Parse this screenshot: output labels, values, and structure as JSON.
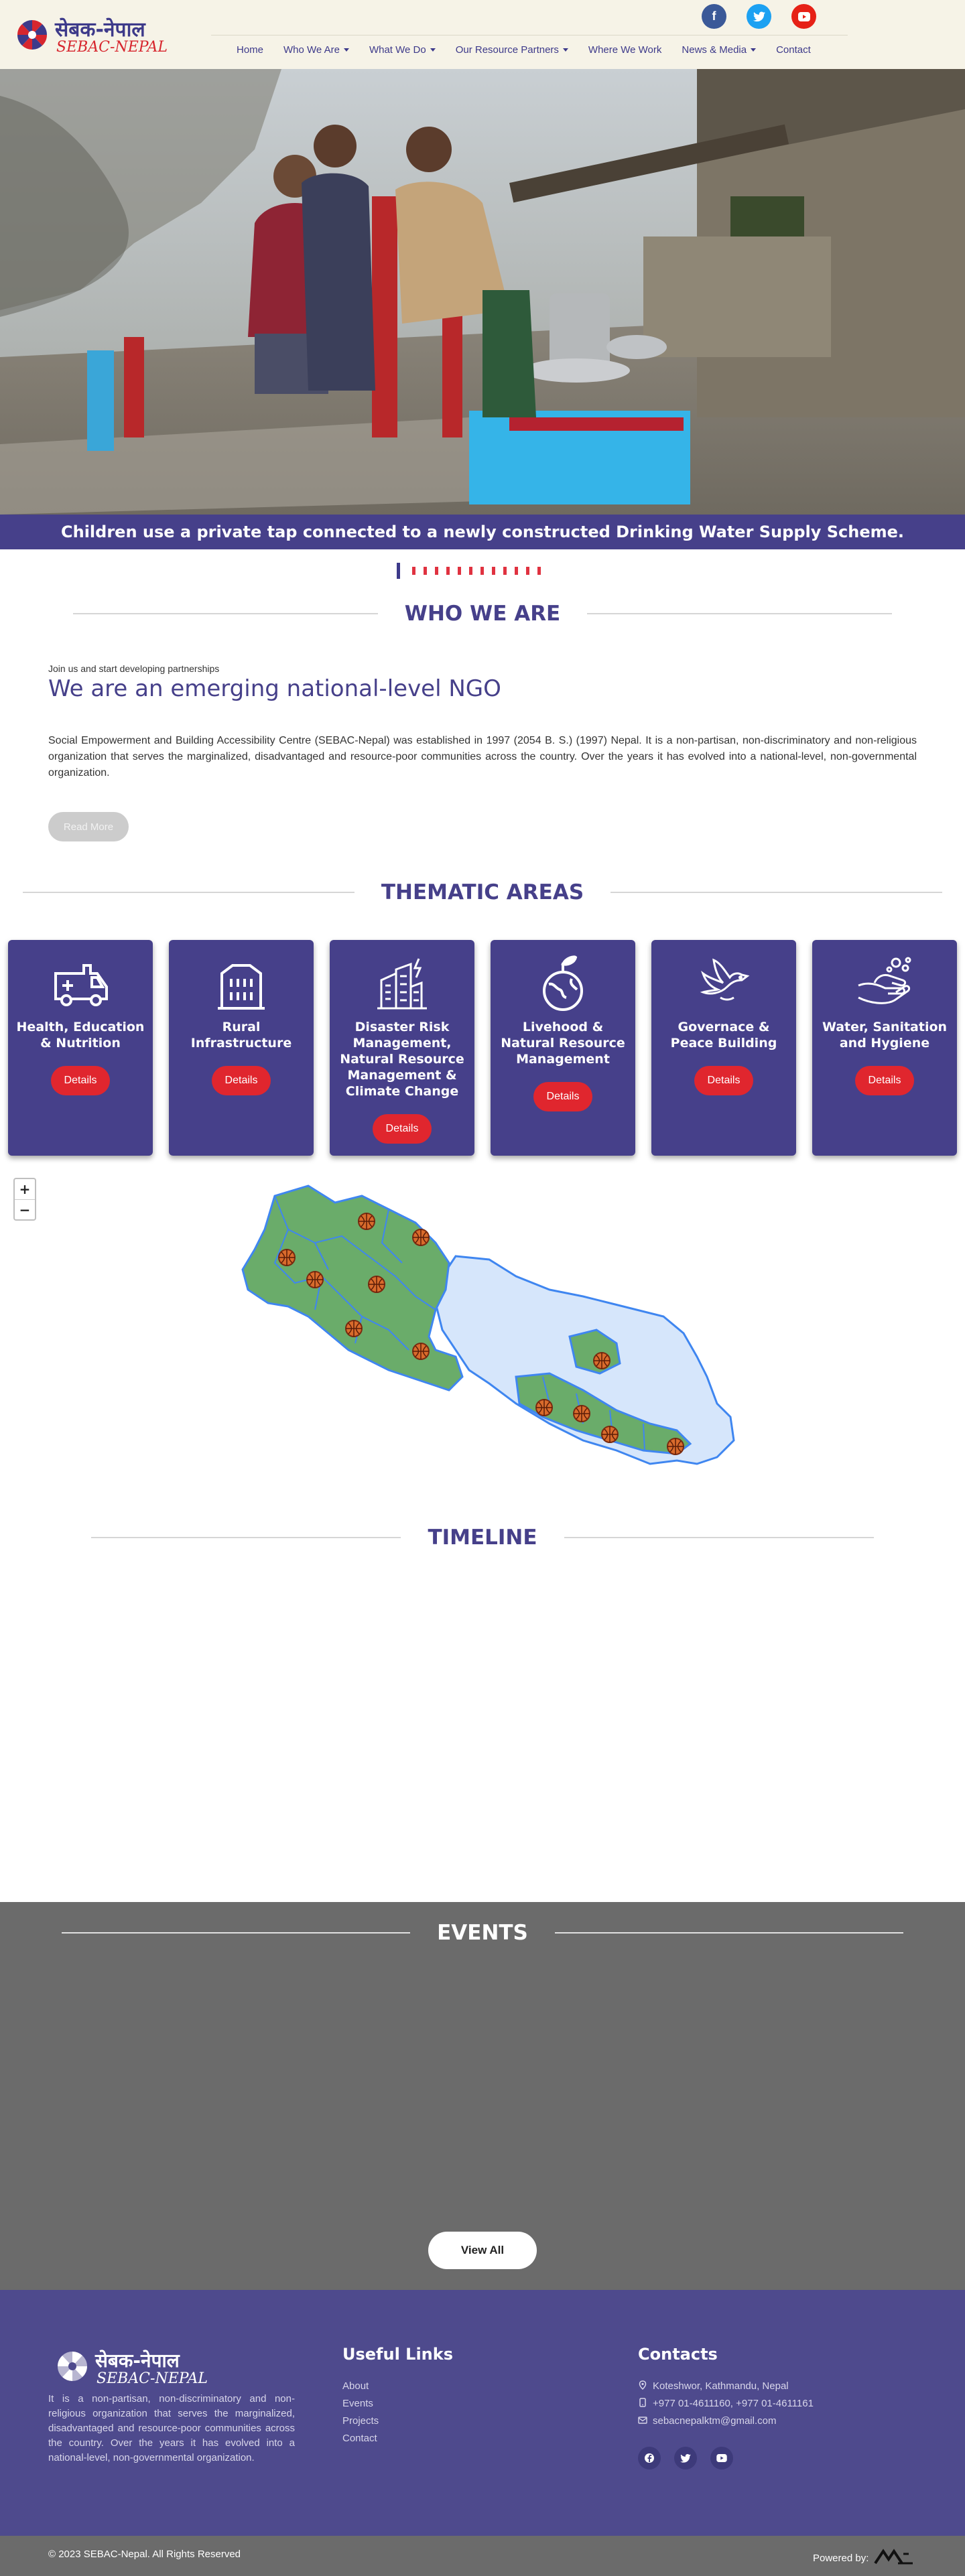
{
  "brand": {
    "name_np": "सेबक-नेपाल",
    "name_en": "SEBAC-NEPAL"
  },
  "header": {
    "social": [
      {
        "name": "facebook-icon",
        "glyph": "f"
      },
      {
        "name": "twitter-icon",
        "glyph": "t"
      },
      {
        "name": "youtube-icon",
        "glyph": "▶"
      }
    ],
    "nav": [
      {
        "label": "Home",
        "dropdown": false
      },
      {
        "label": "Who We Are",
        "dropdown": true
      },
      {
        "label": "What We Do",
        "dropdown": true
      },
      {
        "label": "Our Resource Partners",
        "dropdown": true
      },
      {
        "label": "Where We Work",
        "dropdown": false
      },
      {
        "label": "News & Media",
        "dropdown": true
      },
      {
        "label": "Contact",
        "dropdown": false
      }
    ]
  },
  "hero": {
    "caption": "Children use a private tap connected to a newly constructed Drinking Water Supply Scheme.",
    "slide_count": 13,
    "active_slide": 1
  },
  "who_we_are": {
    "title": "WHO WE ARE",
    "kicker": "Join us and start developing partnerships",
    "heading": "We are an emerging national-level NGO",
    "body": "Social Empowerment and Building Accessibility Centre (SEBAC-Nepal) was established in 1997 (2054 B. S.) (1997) Nepal. It is a non-partisan, non-discriminatory and non-religious organization that serves the marginalized, disadvantaged and resource-poor communities across the country. Over the years it has evolved into a national-level, non-governmental organization.",
    "read_more": "Read More"
  },
  "thematic": {
    "title": "THEMATIC AREAS",
    "details_label": "Details",
    "areas": [
      {
        "title": "Health, Education & Nutrition",
        "icon": "ambulance-icon"
      },
      {
        "title": "Rural Infrastructure",
        "icon": "building-icon"
      },
      {
        "title": "Disaster Risk Management, Natural Resource Management & Climate Change",
        "icon": "collapsed-building-icon"
      },
      {
        "title": "Livehood & Natural Resource Management",
        "icon": "globe-sprout-icon"
      },
      {
        "title": "Governace & Peace Building",
        "icon": "dove-icon"
      },
      {
        "title": "Water, Sanitation and Hygiene",
        "icon": "handwash-icon"
      }
    ]
  },
  "map": {
    "zoom_in": "+",
    "zoom_out": "−",
    "worked_color": "#6aac6a",
    "other_color": "#d6e6fb",
    "border_color": "#3f86f0",
    "marker_count": 12
  },
  "timeline": {
    "title": "TIMELINE"
  },
  "events": {
    "title": "EVENTS",
    "view_all": "View All"
  },
  "footer": {
    "about": "It is a non-partisan, non-discriminatory and non-religious organization that serves the marginalized, disadvantaged and resource-poor communities across the country. Over the years it has evolved into a national-level, non-governmental organization.",
    "useful_links_title": "Useful Links",
    "links": [
      "About",
      "Events",
      "Projects",
      "Contact"
    ],
    "contacts_title": "Contacts",
    "address": "Koteshwor, Kathmandu, Nepal",
    "phone": "+977 01-4611160, +977 01-4611161",
    "email": "sebacnepalktm@gmail.com",
    "copyright": "© 2023 SEBAC-Nepal. All Rights Reserved",
    "powered_by": "Powered by:"
  },
  "colors": {
    "primary": "#46408a",
    "accent": "#e0262e",
    "footer": "#4e4a8d",
    "events_bg": "#6b6b6b"
  }
}
